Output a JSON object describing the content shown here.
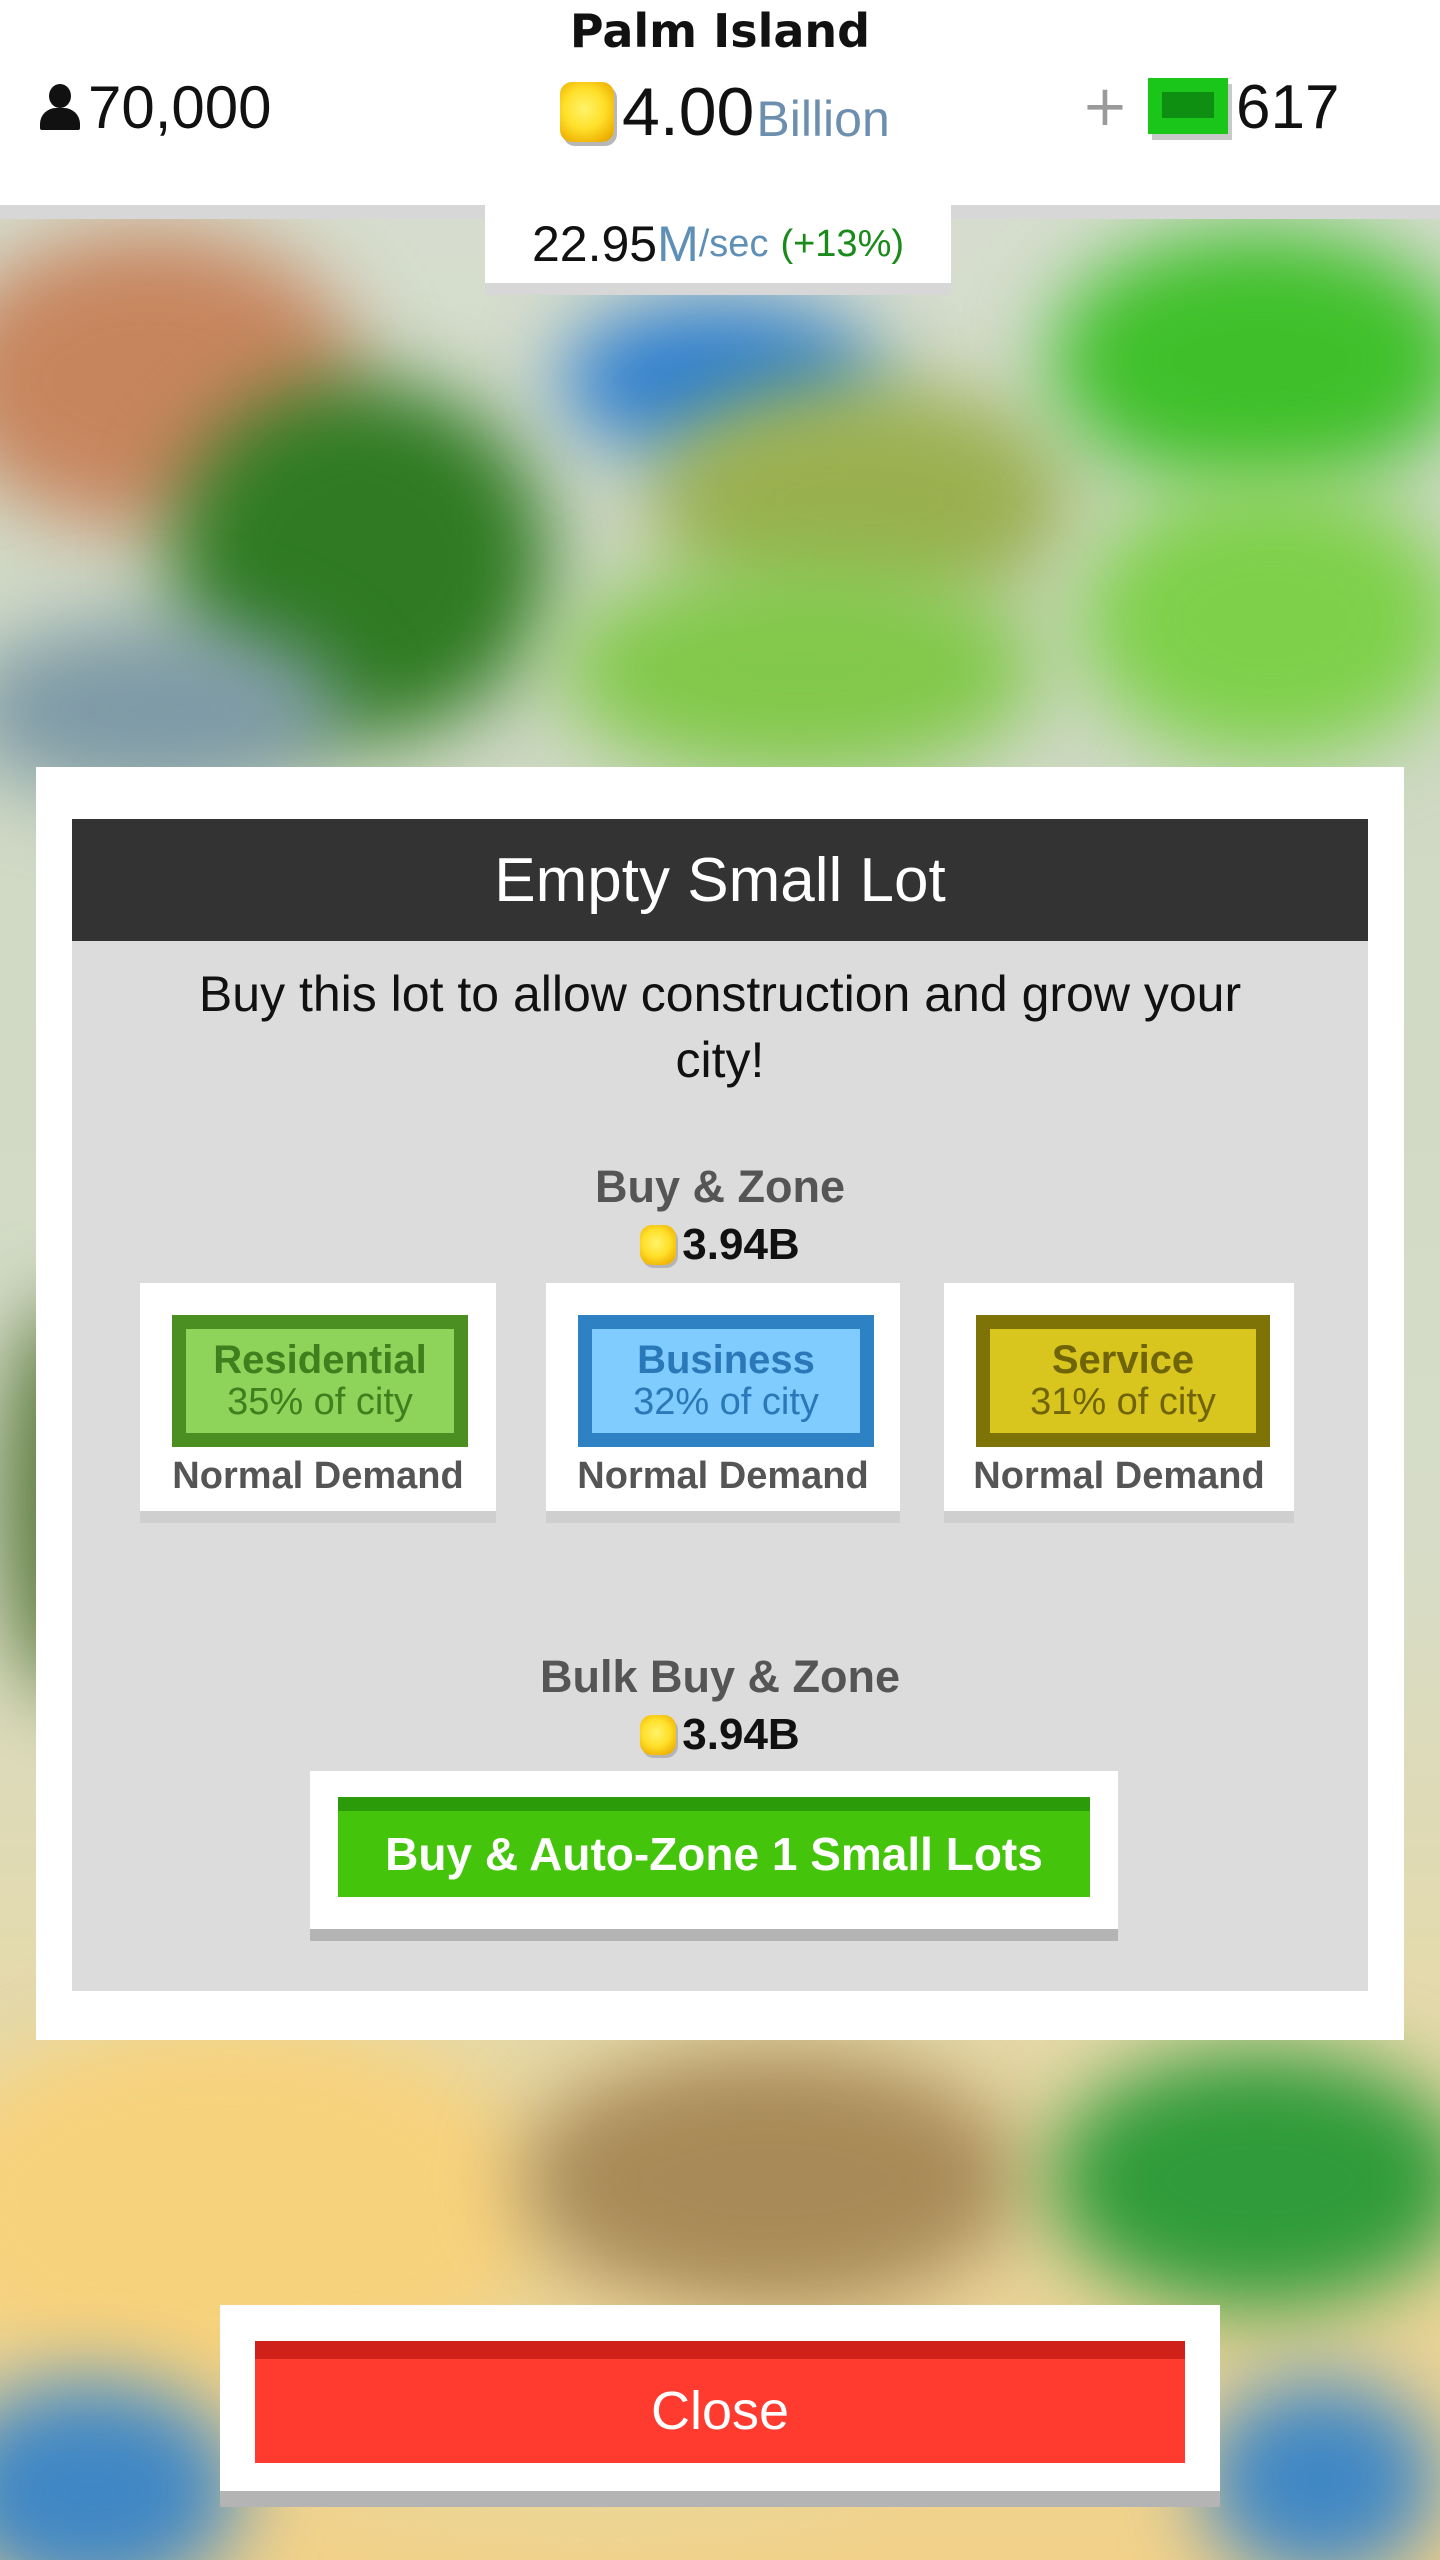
{
  "header": {
    "city_name": "Palm Island",
    "population": "70,000",
    "money_value": "4.00",
    "money_unit": "Billion",
    "plus_label": "+",
    "cash_value": "617"
  },
  "income": {
    "value": "22.95",
    "unit_m": "M",
    "unit_sec": "/sec",
    "bonus": "(+13%)"
  },
  "dialog": {
    "title": "Empty Small Lot",
    "description": "Buy this lot to allow construction and grow your city!",
    "buy_zone": {
      "heading": "Buy & Zone",
      "price": "3.94B",
      "zones": [
        {
          "name": "Residential",
          "share": "35% of city",
          "demand": "Normal Demand",
          "fill": "#8fd45a",
          "border": "#4b8f22",
          "text": "#3f7f1d"
        },
        {
          "name": "Business",
          "share": "32% of city",
          "demand": "Normal Demand",
          "fill": "#80ccff",
          "border": "#2e82c4",
          "text": "#2a78b8"
        },
        {
          "name": "Service",
          "share": "31% of city",
          "demand": "Normal Demand",
          "fill": "#d8c51e",
          "border": "#7e7306",
          "text": "#6f6508"
        }
      ]
    },
    "bulk": {
      "heading": "Bulk Buy & Zone",
      "price": "3.94B",
      "button_label": "Buy & Auto-Zone 1 Small Lots"
    }
  },
  "close_label": "Close",
  "colors": {
    "title_bar": "#333333",
    "bulk_button": "#44c40b",
    "close_button": "#ff3a2f",
    "coin": "#ffe02a",
    "cash": "#19c619"
  },
  "icons": {
    "population": "person-icon",
    "money": "coin-icon",
    "cash": "cash-icon"
  }
}
